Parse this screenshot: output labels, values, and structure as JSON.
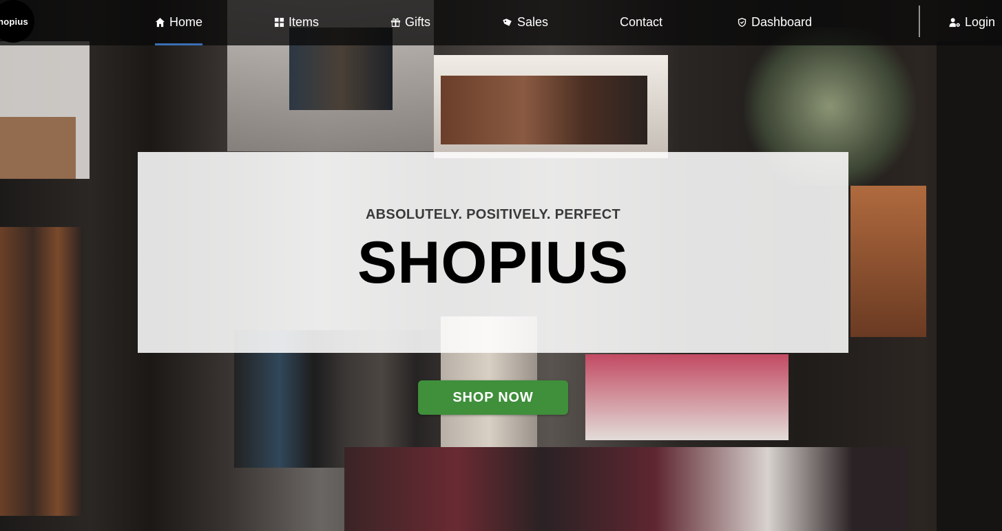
{
  "nav": {
    "logo": "hopius",
    "items": [
      {
        "label": "Home",
        "icon": "home-icon"
      },
      {
        "label": "Items",
        "icon": "grid-icon"
      },
      {
        "label": "Gifts",
        "icon": "gift-icon"
      },
      {
        "label": "Sales",
        "icon": "tag-icon"
      },
      {
        "label": "Contact",
        "icon": ""
      },
      {
        "label": "Dashboard",
        "icon": "shield-icon"
      }
    ],
    "login": {
      "label": "Login",
      "icon": "user-gear-icon"
    }
  },
  "hero": {
    "tagline": "ABSOLUTELY. POSITIVELY. PERFECT",
    "brand": "SHOPIUS",
    "cta": "SHOP NOW"
  },
  "colors": {
    "accent_green": "#3f8f3b",
    "active_underline": "#3b6fb5",
    "navbar_bg": "#0a0a0a"
  }
}
